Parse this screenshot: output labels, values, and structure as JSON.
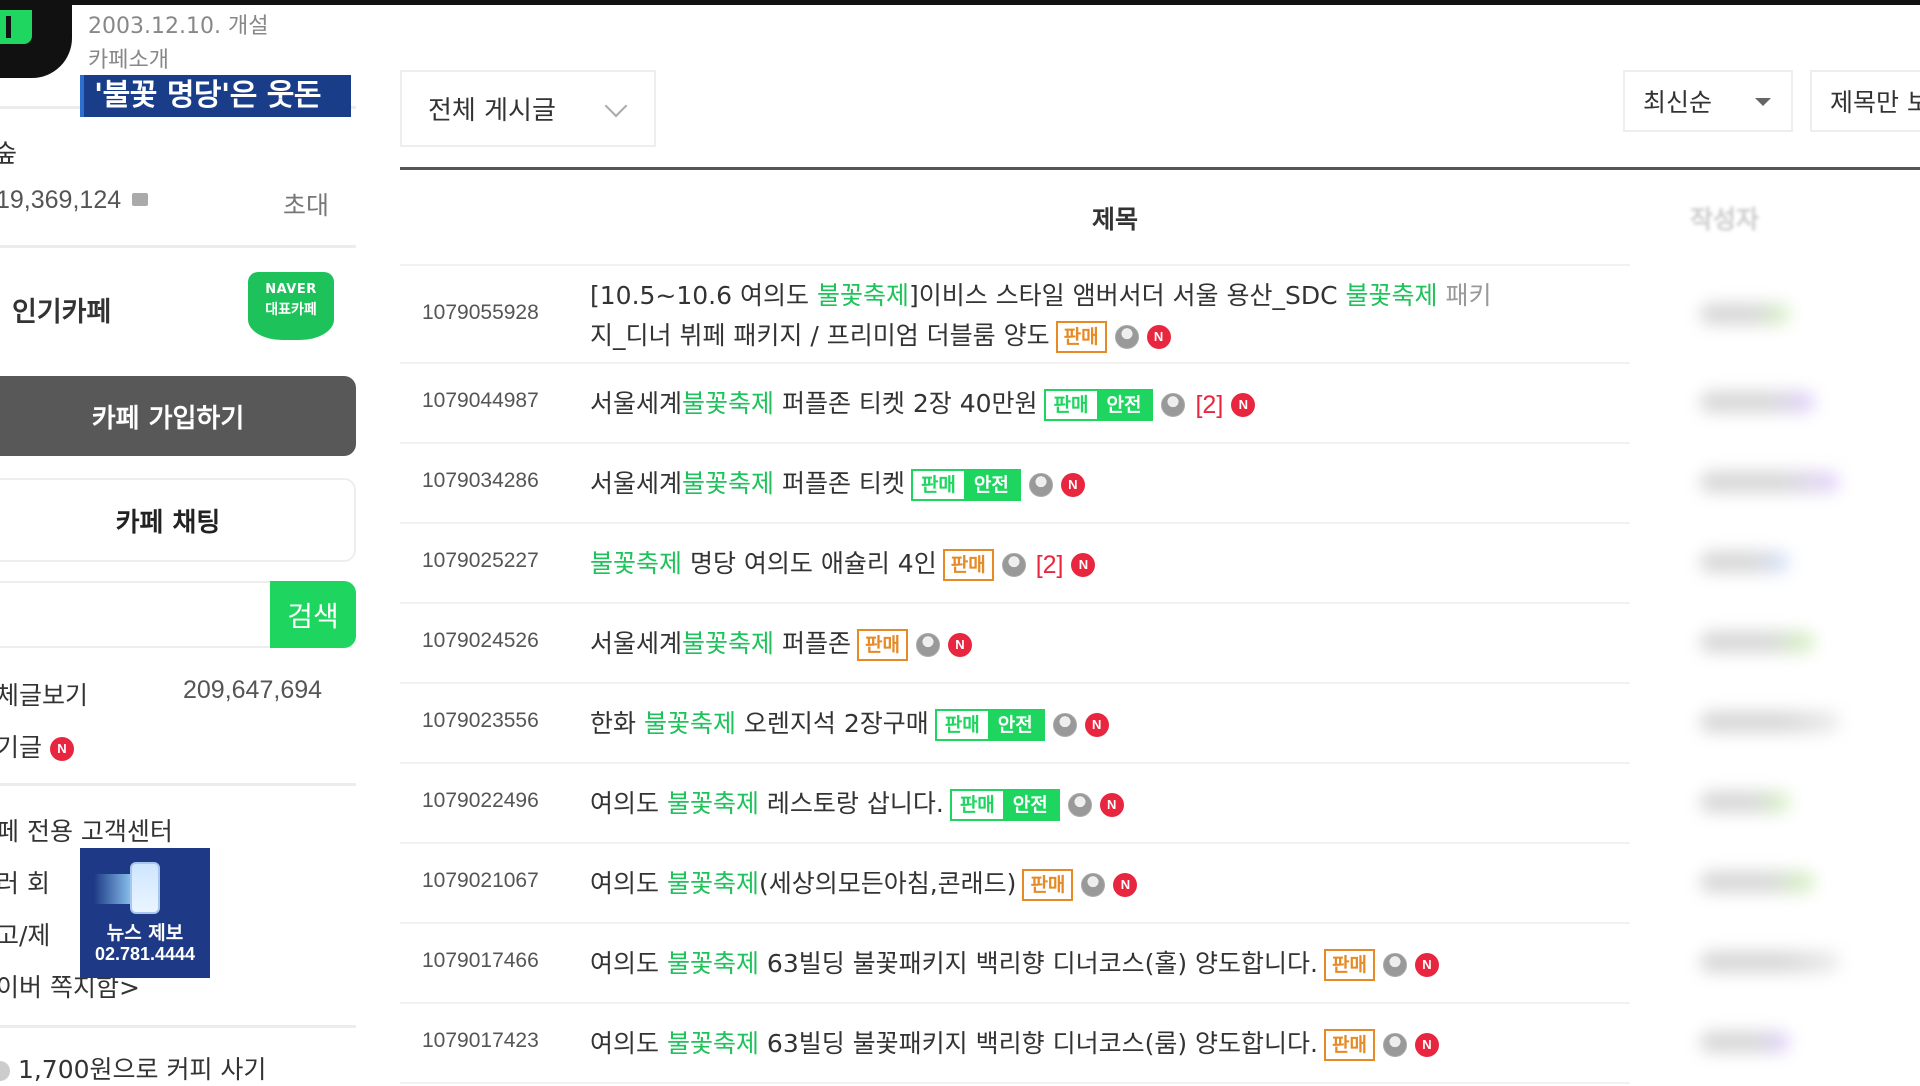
{
  "cafe_info": {
    "founded": "2003.12.10. 개설",
    "intro_link": "카페소개",
    "name_partial": "숲",
    "member_count": "19,369,124",
    "invite_label": "초대",
    "popular_cafe_label": "인기카페",
    "naver_badge_line1": "NAVER",
    "naver_badge_line2": "대표카페"
  },
  "news_banner": {
    "headline": "'불꽃 명당'은 웃돈",
    "tip_label": "뉴스 제보",
    "tip_phone": "02.781.4444"
  },
  "sidebar": {
    "join_button": "카페 가입하기",
    "chat_button": "카페 채팅",
    "search_placeholder": "",
    "search_button": "검색",
    "all_posts_label": "체글보기",
    "all_posts_count": "209,647,694",
    "popular_posts_label": "기글",
    "new_badge": "N",
    "links": [
      "페 전용 고객센터",
      "러 회",
      "고/제",
      "이버 쪽지함>"
    ],
    "coffee_link": "1,700원으로 커피 사기"
  },
  "filters": {
    "board_select": "전체 게시글",
    "sort_select": "최신순",
    "title_only_select": "제목만 보기"
  },
  "table": {
    "headers": {
      "title": "제목",
      "author": "작성자"
    },
    "rows": [
      {
        "id": "1079055928",
        "pre": "[10.5~10.6 여의도 ",
        "hl": "불꽃축제",
        "post": "]이비스 스타일 앰버서더 서울 용산_SDC ",
        "hl2": "불꽃축제",
        "post2": " 패키",
        "line2": "지_디너 뷔페 패키지 / 프리미엄 더블룸 양도",
        "tags": [
          "판매"
        ],
        "safe": false,
        "comments": "",
        "new": true
      },
      {
        "id": "1079044987",
        "pre": "서울세계",
        "hl": "불꽃축제",
        "post": " 퍼플존 티켓 2장 40만원",
        "tags": [
          "판매",
          "안전"
        ],
        "safe": true,
        "comments": "[2]",
        "new": true
      },
      {
        "id": "1079034286",
        "pre": "서울세계",
        "hl": "불꽃축제",
        "post": " 퍼플존 티켓",
        "tags": [
          "판매",
          "안전"
        ],
        "safe": true,
        "comments": "",
        "new": true
      },
      {
        "id": "1079025227",
        "pre": "",
        "hl": "불꽃축제",
        "post": " 명당 여의도 애슐리 4인",
        "tags": [
          "판매"
        ],
        "safe": false,
        "comments": "[2]",
        "new": true
      },
      {
        "id": "1079024526",
        "pre": "서울세계",
        "hl": "불꽃축제",
        "post": " 퍼플존",
        "tags": [
          "판매"
        ],
        "safe": false,
        "comments": "",
        "new": true
      },
      {
        "id": "1079023556",
        "pre": "한화 ",
        "hl": "불꽃축제",
        "post": " 오렌지석 2장구매",
        "tags": [
          "판매",
          "안전"
        ],
        "safe": true,
        "comments": "",
        "new": true
      },
      {
        "id": "1079022496",
        "pre": "여의도 ",
        "hl": "불꽃축제",
        "post": " 레스토랑 삽니다.",
        "tags": [
          "판매",
          "안전"
        ],
        "safe": true,
        "comments": "",
        "new": true
      },
      {
        "id": "1079021067",
        "pre": "여의도 ",
        "hl": "불꽃축제",
        "post": "(세상의모든아침,콘래드)",
        "tags": [
          "판매"
        ],
        "safe": false,
        "comments": "",
        "new": true
      },
      {
        "id": "1079017466",
        "pre": "여의도 ",
        "hl": "불꽃축제",
        "post": " 63빌딩 불꽃패키지 백리향 디너코스(홀) 양도합니다.",
        "tags": [
          "판매"
        ],
        "safe": false,
        "comments": "",
        "new": true
      },
      {
        "id": "1079017423",
        "pre": "여의도 ",
        "hl": "불꽃축제",
        "post": " 63빌딩 불꽃패키지 백리향 디너코스(룸) 양도합니다.",
        "tags": [
          "판매"
        ],
        "safe": false,
        "comments": "",
        "new": true
      }
    ]
  },
  "colors": {
    "highlight_green": "#1ec25a",
    "sale_tag_orange": "#e58a25",
    "safe_tag_green": "#1ed65f",
    "new_badge_red": "#e8263f",
    "banner_blue": "#1a3d8a"
  }
}
